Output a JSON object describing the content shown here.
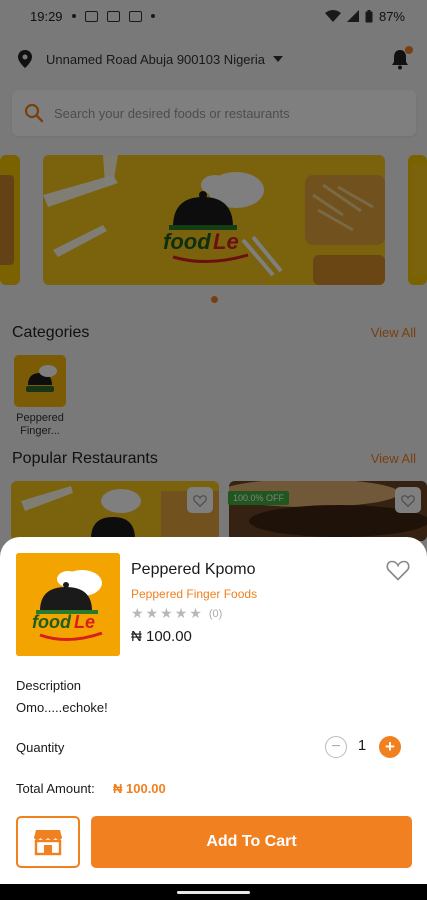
{
  "status_bar": {
    "time": "19:29",
    "battery": "87%"
  },
  "header": {
    "address": "Unnamed Road Abuja 900103 Nigeria"
  },
  "search": {
    "placeholder": "Search your desired foods or restaurants"
  },
  "banner": {
    "brand_a": "food",
    "brand_b": "Le"
  },
  "categories": {
    "title": "Categories",
    "view_all": "View All",
    "items": [
      {
        "label": "Peppered Finger..."
      }
    ]
  },
  "popular": {
    "title": "Popular Restaurants",
    "view_all": "View All",
    "discount": "100.0% OFF"
  },
  "sheet": {
    "name": "Peppered Kpomo",
    "restaurant": "Peppered Finger Foods",
    "rating_count": "(0)",
    "price": "₦ 100.00",
    "description_label": "Description",
    "description": "Omo.....echoke!",
    "quantity_label": "Quantity",
    "quantity": "1",
    "total_label": "Total Amount:",
    "total": "₦ 100.00",
    "add_to_cart": "Add To Cart",
    "stars": 0
  },
  "colors": {
    "accent": "#f08020",
    "banner": "#f5c400"
  }
}
